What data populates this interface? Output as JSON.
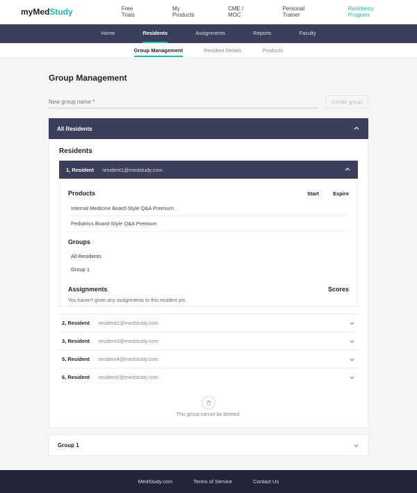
{
  "logo": {
    "p1": "my",
    "p2": "Med",
    "p3": "Study"
  },
  "topNav": {
    "freeTrials": "Free Trials",
    "myProducts": "My Products",
    "cme": "CME / MOC",
    "trainer": "Personal Trainer",
    "residency": "Residency Program"
  },
  "subNav": {
    "home": "Home",
    "residents": "Residents",
    "assignments": "Assignments",
    "reports": "Reports",
    "faculty": "Faculty"
  },
  "tertiary": {
    "group": "Group Management",
    "details": "Resident Details",
    "products": "Products"
  },
  "page": {
    "title": "Group Management",
    "newGroupPlaceholder": "New group name *",
    "createBtn": "Create group"
  },
  "allResidents": {
    "header": "All Residents",
    "sectionTitle": "Residents",
    "openResident": {
      "name": "1, Resident",
      "email": "resident1@medstudy.com",
      "productsHeader": "Products",
      "startCol": "Start",
      "expireCol": "Expire",
      "products": [
        "Internal Medicine Board-Style Q&A Premium",
        "Pediatrics Board-Style Q&A Premium"
      ],
      "groupsHeader": "Groups",
      "groups": [
        "All Residents",
        "Group 1"
      ],
      "assignmentsHeader": "Assignments",
      "scoresHeader": "Scores",
      "assignmentsEmpty": "You haven't given any assignments to this resident yet."
    },
    "rows": [
      {
        "name": "2, Resident",
        "email": "resident2@medstudy.com"
      },
      {
        "name": "3, Resident",
        "email": "resident3@medstudy.com"
      },
      {
        "name": "5, Resident",
        "email": "resident4@medstudy.com"
      },
      {
        "name": "6, Resident",
        "email": "resident5@medstudy.com"
      }
    ],
    "deleteText": "This group cannot be deleted."
  },
  "group1": {
    "label": "Group 1"
  },
  "footer": {
    "site": "MedStudy.com",
    "tos": "Terms of Service",
    "contact": "Contact Us"
  }
}
